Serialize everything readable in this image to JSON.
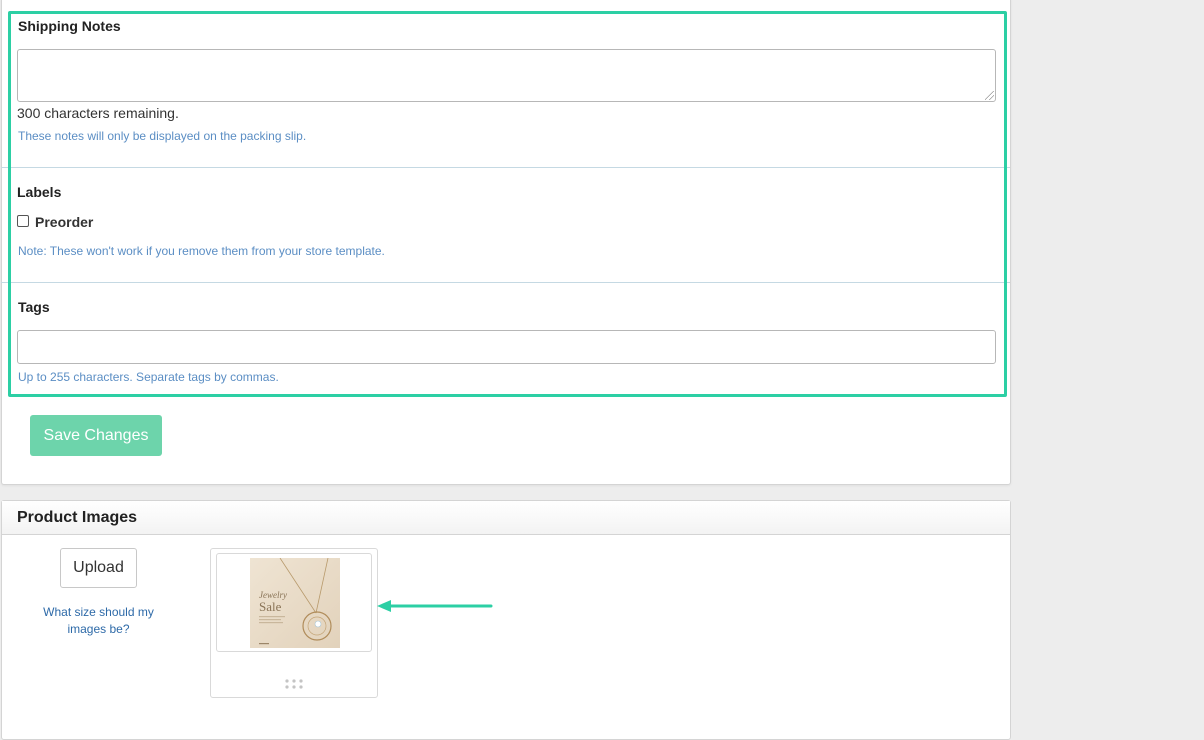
{
  "shipping_notes": {
    "label": "Shipping Notes",
    "value": "",
    "remaining": "300 characters remaining.",
    "help": "These notes will only be displayed on the packing slip."
  },
  "labels": {
    "title": "Labels",
    "preorder_label": "Preorder",
    "preorder_checked": false,
    "note": "Note: These won't work if you remove them from your store template."
  },
  "tags": {
    "label": "Tags",
    "value": "",
    "help": "Up to 255 characters. Separate tags by commas."
  },
  "save_button": "Save Changes",
  "product_images": {
    "title": "Product Images",
    "upload_button": "Upload",
    "size_link": "What size should my images be?",
    "thumbnail": {
      "image_title": "Jewelry",
      "image_subtitle": "Sale"
    }
  },
  "colors": {
    "highlight": "#2ccfa4",
    "save_button": "#6dd4ab",
    "help_text": "#5b8ec4",
    "link": "#2e6aa8"
  }
}
